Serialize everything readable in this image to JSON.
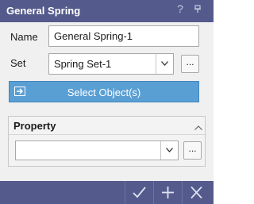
{
  "title": "General Spring",
  "title_icons": {
    "help": "?",
    "pin": "pin-icon"
  },
  "fields": {
    "name_label": "Name",
    "name_value": "General Spring-1",
    "set_label": "Set",
    "set_value": "Spring Set-1",
    "set_more": "..."
  },
  "select_button": "Select Object(s)",
  "property": {
    "header": "Property",
    "combo_value": "",
    "more": "..."
  },
  "footer": {
    "ok_icon": "check-icon",
    "add_icon": "plus-icon",
    "close_icon": "close-icon"
  },
  "colors": {
    "titlebar": "#545b8c",
    "accent_button": "#5a9fd4"
  }
}
